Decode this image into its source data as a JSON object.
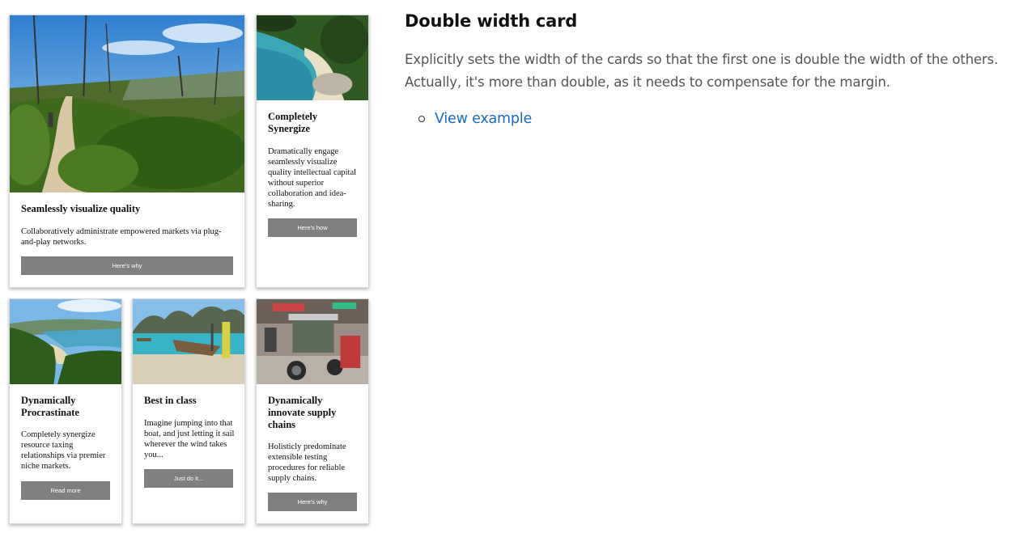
{
  "cards": [
    {
      "image": "beach-trail-photo",
      "title": "Seamlessly visualize quality",
      "text": "Collaboratively administrate empowered markets via plug-and-play networks.",
      "button": "Here's why"
    },
    {
      "image": "cove-aerial-photo",
      "title": "Completely Synergize",
      "text": "Dramatically engage seamlessly visualize quality intellectual capital without superior collaboration and idea-sharing.",
      "button": "Here's how"
    },
    {
      "image": "tropical-bay-photo",
      "title": "Dynamically Procrastinate",
      "text": "Completely synergize resource taxing relationships via premier niche markets.",
      "button": "Read more"
    },
    {
      "image": "longtail-boat-photo",
      "title": "Best in class",
      "text": "Imagine jumping into that boat, and just letting it sail wherever the wind takes you...",
      "button": "Just do it..."
    },
    {
      "image": "tuk-tuk-street-photo",
      "title": "Dynamically innovate supply chains",
      "text": "Holisticly predominate extensible testing procedures for reliable supply chains.",
      "button": "Here's why"
    }
  ],
  "section": {
    "heading": "Double width card",
    "description": "Explicitly sets the width of the cards so that the first one is double the width of the others. Actually, it's more than double, as it needs to compensate for the margin.",
    "links": [
      {
        "label": "View example",
        "bullet_icon": "circle-bullet-icon"
      }
    ]
  },
  "colors": {
    "button": "#808080",
    "link": "#1a6ac2",
    "description": "#555555"
  }
}
